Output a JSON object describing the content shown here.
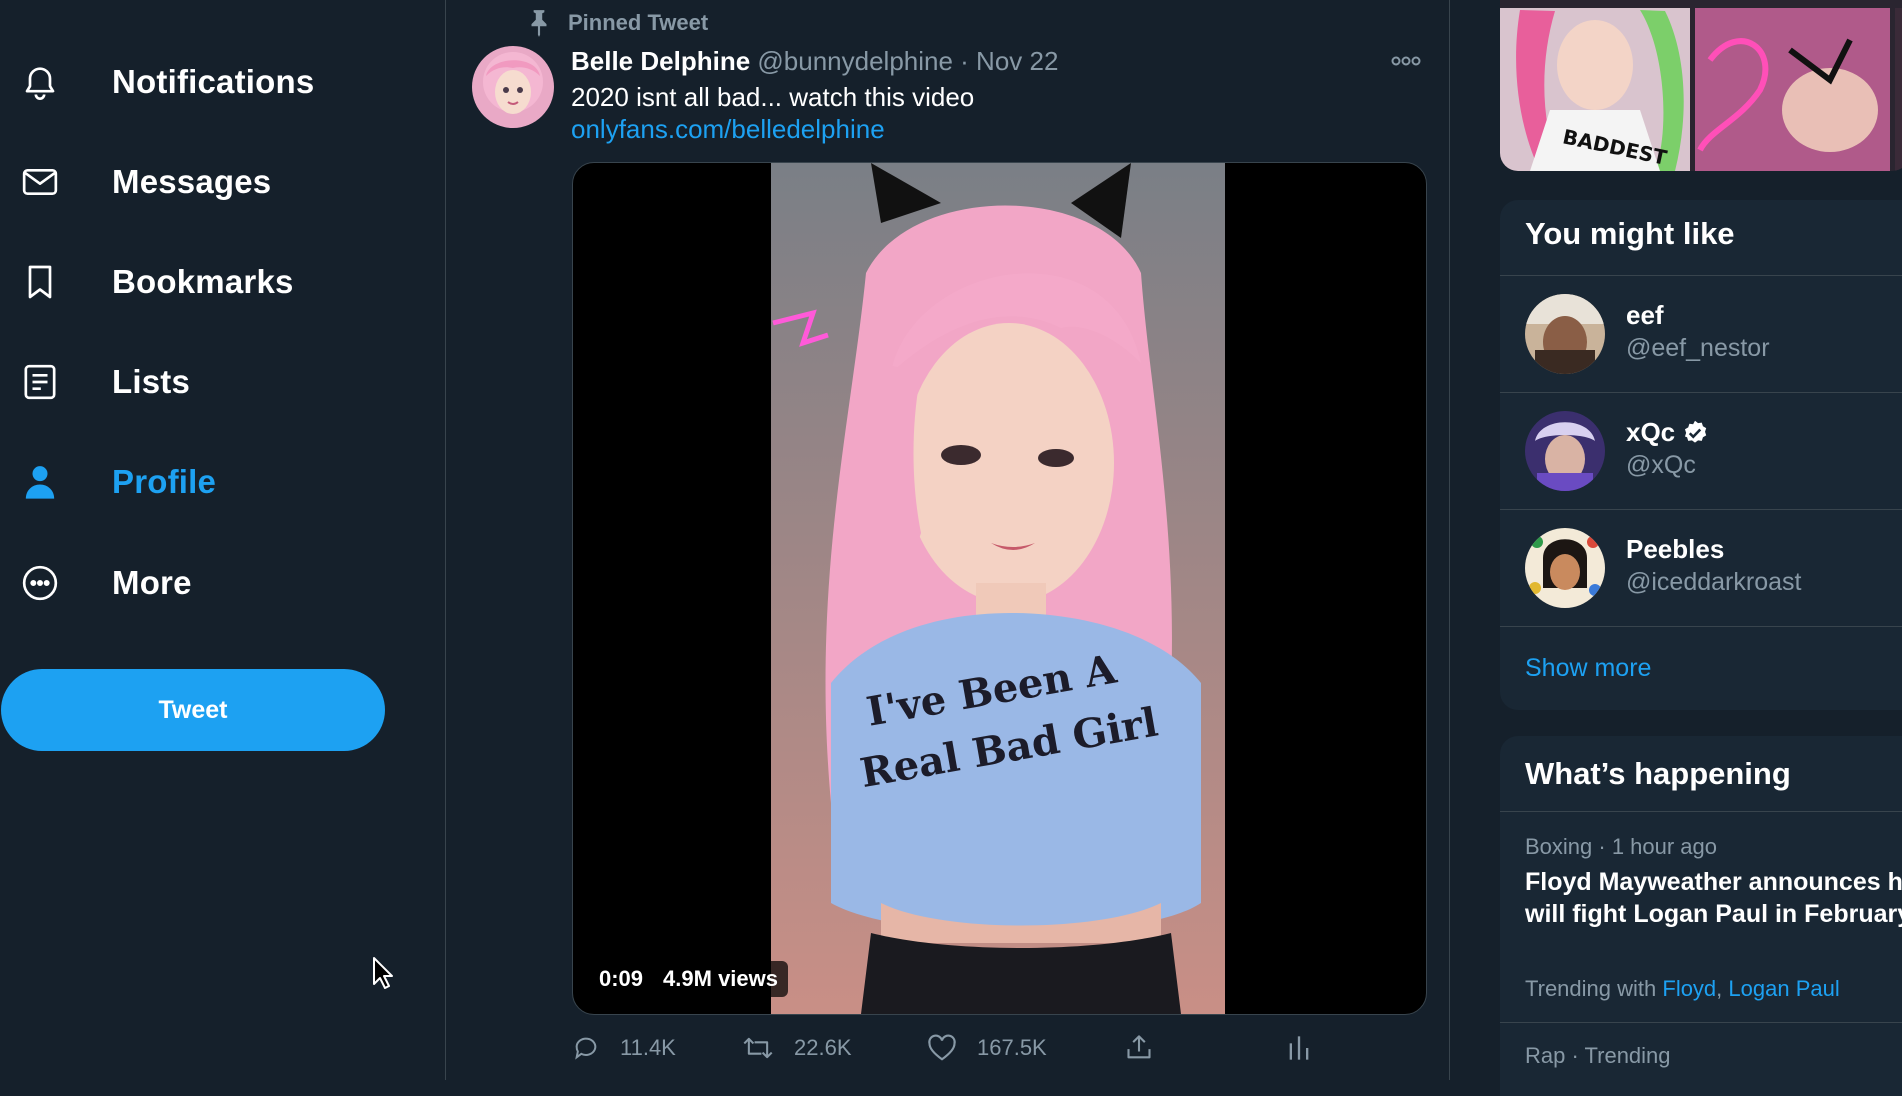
{
  "nav": {
    "items": [
      {
        "label": "Notifications",
        "icon": "bell-icon",
        "active": false
      },
      {
        "label": "Messages",
        "icon": "envelope-icon",
        "active": false
      },
      {
        "label": "Bookmarks",
        "icon": "bookmark-icon",
        "active": false
      },
      {
        "label": "Lists",
        "icon": "list-icon",
        "active": false
      },
      {
        "label": "Profile",
        "icon": "person-icon",
        "active": true
      },
      {
        "label": "More",
        "icon": "more-circle-icon",
        "active": false
      }
    ],
    "tweet_button": "Tweet"
  },
  "tweet": {
    "pinned_label": "Pinned Tweet",
    "author_name": "Belle Delphine",
    "author_handle": "@bunnydelphine",
    "date": "· Nov 22",
    "text": "2020 isnt all bad... watch this video",
    "link": "onlyfans.com/belledelphine",
    "video_time": "0:09",
    "video_views": "4.9M views",
    "replies": "11.4K",
    "retweets": "22.6K",
    "likes": "167.5K"
  },
  "you_might_like": {
    "title": "You might like",
    "users": [
      {
        "name": "eef",
        "handle": "@eef_nestor",
        "verified": false
      },
      {
        "name": "xQc",
        "handle": "@xQc",
        "verified": true
      },
      {
        "name": "Peebles",
        "handle": "@iceddarkroast",
        "verified": false
      }
    ],
    "show_more": "Show more"
  },
  "whats_happening": {
    "title": "What’s happening",
    "trends": [
      {
        "meta": "Boxing · 1 hour ago",
        "title": "Floyd Mayweather announces he will fight Logan Paul in February",
        "with_label": "Trending with",
        "with_links": [
          "Floyd",
          "Logan Paul"
        ],
        "link_sep": ","
      },
      {
        "meta": "Rap · Trending"
      }
    ]
  },
  "colors": {
    "background": "#15202b",
    "panel": "#192734",
    "accent": "#1da1f2",
    "muted": "#8899a6",
    "border": "#38444d"
  }
}
